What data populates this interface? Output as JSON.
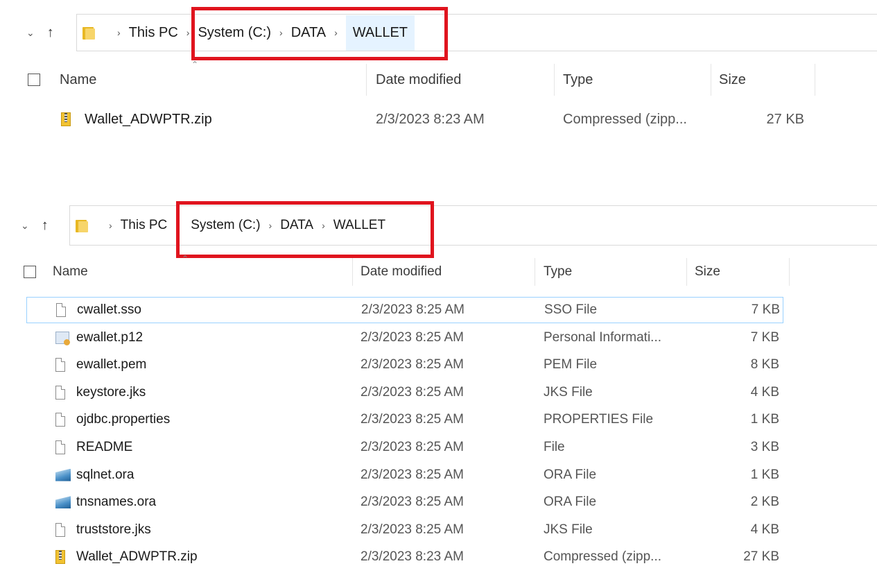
{
  "top_window": {
    "breadcrumb": [
      "This PC",
      "System (C:)",
      "DATA",
      "WALLET"
    ],
    "columns": {
      "name": "Name",
      "date": "Date modified",
      "type": "Type",
      "size": "Size"
    },
    "files": [
      {
        "name": "Wallet_ADWPTR.zip",
        "date": "2/3/2023 8:23 AM",
        "type": "Compressed (zipp...",
        "size": "27 KB",
        "icon": "zip-folder-icon"
      }
    ]
  },
  "bottom_window": {
    "breadcrumb": [
      "This PC",
      "System (C:)",
      "DATA",
      "WALLET"
    ],
    "columns": {
      "name": "Name",
      "date": "Date modified",
      "type": "Type",
      "size": "Size"
    },
    "files": [
      {
        "name": "cwallet.sso",
        "date": "2/3/2023 8:25 AM",
        "type": "SSO File",
        "size": "7 KB",
        "icon": "file-icon"
      },
      {
        "name": "ewallet.p12",
        "date": "2/3/2023 8:25 AM",
        "type": "Personal Informati...",
        "size": "7 KB",
        "icon": "certificate-icon"
      },
      {
        "name": "ewallet.pem",
        "date": "2/3/2023 8:25 AM",
        "type": "PEM File",
        "size": "8 KB",
        "icon": "file-icon"
      },
      {
        "name": "keystore.jks",
        "date": "2/3/2023 8:25 AM",
        "type": "JKS File",
        "size": "4 KB",
        "icon": "file-icon"
      },
      {
        "name": "ojdbc.properties",
        "date": "2/3/2023 8:25 AM",
        "type": "PROPERTIES File",
        "size": "1 KB",
        "icon": "file-icon"
      },
      {
        "name": "README",
        "date": "2/3/2023 8:25 AM",
        "type": "File",
        "size": "3 KB",
        "icon": "file-icon"
      },
      {
        "name": "sqlnet.ora",
        "date": "2/3/2023 8:25 AM",
        "type": "ORA File",
        "size": "1 KB",
        "icon": "ora-file-icon"
      },
      {
        "name": "tnsnames.ora",
        "date": "2/3/2023 8:25 AM",
        "type": "ORA File",
        "size": "2 KB",
        "icon": "ora-file-icon"
      },
      {
        "name": "truststore.jks",
        "date": "2/3/2023 8:25 AM",
        "type": "JKS File",
        "size": "4 KB",
        "icon": "file-icon"
      },
      {
        "name": "Wallet_ADWPTR.zip",
        "date": "2/3/2023 8:23 AM",
        "type": "Compressed (zipp...",
        "size": "27 KB",
        "icon": "zip-folder-icon"
      }
    ]
  },
  "colors": {
    "highlight_box": "#e0141e",
    "selection_border": "#99d1ff",
    "current_crumb_bg": "#e5f3ff"
  }
}
